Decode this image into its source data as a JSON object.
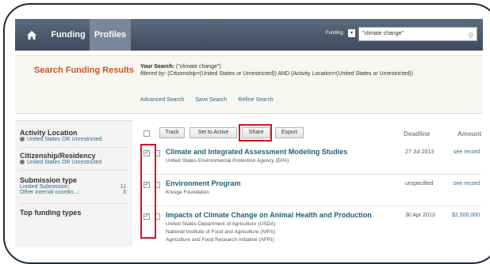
{
  "nav": {
    "tabs": [
      "Funding",
      "Profiles"
    ],
    "scope_label": "Funding",
    "search_value": "\"climate change\""
  },
  "results_header": {
    "title": "Search Funding Results",
    "your_search_label": "Your Search:",
    "your_search_query": "(\"climate change\")",
    "filtered_label": "filtered by:",
    "filtered_text": "(Citizenship=(United States or Unrestricted)) AND (Activity Location=(United States or Unrestricted))",
    "links": [
      "Advanced Search",
      "Save Search",
      "Refine Search"
    ]
  },
  "sidebar": {
    "activity_location": {
      "heading": "Activity Location",
      "item": "United States OR Unrestricted"
    },
    "citizenship": {
      "heading": "Citizenship/Residency",
      "item": "United States OR Unrestricted"
    },
    "submission": {
      "heading": "Submission type",
      "rows": [
        {
          "label": "Limited Submission:",
          "count": "11"
        },
        {
          "label": "Other internal coordin...:",
          "count": "3"
        }
      ]
    },
    "top_funding_heading": "Top funding types"
  },
  "toolbar": {
    "buttons": [
      "Track",
      "Set to Active",
      "Share",
      "Export"
    ],
    "col_deadline": "Deadline",
    "col_amount": "Amount"
  },
  "results": [
    {
      "title": "Climate and Integrated Assessment Modeling Studies",
      "agencies": [
        "United States Environmental Protection Agency (EPA)"
      ],
      "deadline": "27 Jul 2013",
      "amount": "see record",
      "checked": true
    },
    {
      "title": "Environment Program",
      "agencies": [
        "Kresge Foundation"
      ],
      "deadline": "unspecified",
      "amount": "see record",
      "checked": true
    },
    {
      "title": "Impacts of Climate Change on Animal Health and Production",
      "agencies": [
        "United States Department of Agriculture (USDA)",
        "National Institute of Food and Agriculture (NIFA)",
        "Agriculture and Food Research Initiative (AFRI)"
      ],
      "deadline": "30 Apr 2013",
      "amount": "$2,500,000",
      "checked": true
    }
  ],
  "colors": {
    "nav": "#4a5668",
    "accent_title": "#c8562a",
    "link": "#2a6b8a",
    "highlight": "#d8141b"
  }
}
